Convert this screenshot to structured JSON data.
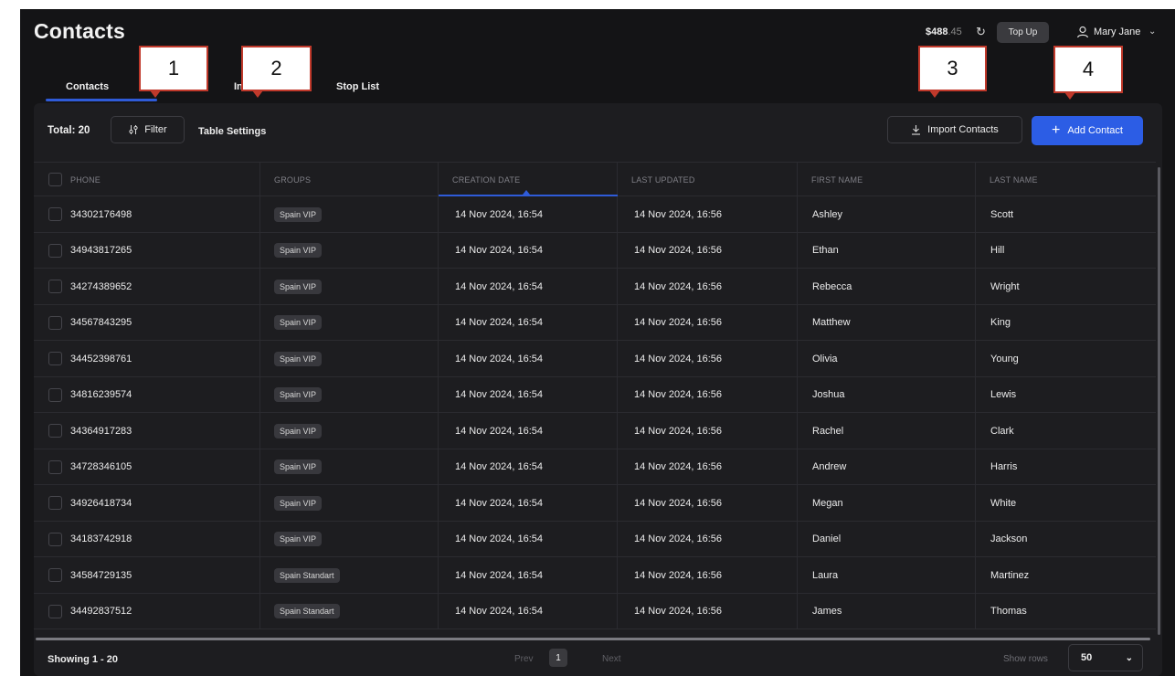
{
  "header": {
    "title": "Contacts",
    "balance_main": "$488",
    "balance_decimal": ".45",
    "topup_label": "Top Up",
    "user_name": "Mary Jane"
  },
  "tabs": [
    {
      "label": "Contacts",
      "active": true
    },
    {
      "label": "In"
    },
    {
      "label": "Stop List"
    }
  ],
  "toolbar": {
    "total_label": "Total: 20",
    "filter_label": "Filter",
    "table_settings_label": "Table Settings",
    "import_label": "Import Contacts",
    "add_label": "Add Contact"
  },
  "table": {
    "columns": [
      "PHONE",
      "GROUPS",
      "CREATION DATE",
      "LAST UPDATED",
      "FIRST NAME",
      "LAST NAME"
    ],
    "sorted_column": "CREATION DATE",
    "rows": [
      {
        "phone": "34302176498",
        "group": "Spain VIP",
        "created": "14 Nov 2024, 16:54",
        "updated": "14 Nov 2024, 16:56",
        "first": "Ashley",
        "last": "Scott"
      },
      {
        "phone": "34943817265",
        "group": "Spain VIP",
        "created": "14 Nov 2024, 16:54",
        "updated": "14 Nov 2024, 16:56",
        "first": "Ethan",
        "last": "Hill"
      },
      {
        "phone": "34274389652",
        "group": "Spain VIP",
        "created": "14 Nov 2024, 16:54",
        "updated": "14 Nov 2024, 16:56",
        "first": "Rebecca",
        "last": "Wright"
      },
      {
        "phone": "34567843295",
        "group": "Spain VIP",
        "created": "14 Nov 2024, 16:54",
        "updated": "14 Nov 2024, 16:56",
        "first": "Matthew",
        "last": "King"
      },
      {
        "phone": "34452398761",
        "group": "Spain VIP",
        "created": "14 Nov 2024, 16:54",
        "updated": "14 Nov 2024, 16:56",
        "first": "Olivia",
        "last": "Young"
      },
      {
        "phone": "34816239574",
        "group": "Spain VIP",
        "created": "14 Nov 2024, 16:54",
        "updated": "14 Nov 2024, 16:56",
        "first": "Joshua",
        "last": "Lewis"
      },
      {
        "phone": "34364917283",
        "group": "Spain VIP",
        "created": "14 Nov 2024, 16:54",
        "updated": "14 Nov 2024, 16:56",
        "first": "Rachel",
        "last": "Clark"
      },
      {
        "phone": "34728346105",
        "group": "Spain VIP",
        "created": "14 Nov 2024, 16:54",
        "updated": "14 Nov 2024, 16:56",
        "first": "Andrew",
        "last": "Harris"
      },
      {
        "phone": "34926418734",
        "group": "Spain VIP",
        "created": "14 Nov 2024, 16:54",
        "updated": "14 Nov 2024, 16:56",
        "first": "Megan",
        "last": "White"
      },
      {
        "phone": "34183742918",
        "group": "Spain VIP",
        "created": "14 Nov 2024, 16:54",
        "updated": "14 Nov 2024, 16:56",
        "first": "Daniel",
        "last": "Jackson"
      },
      {
        "phone": "34584729135",
        "group": "Spain Standart",
        "created": "14 Nov 2024, 16:54",
        "updated": "14 Nov 2024, 16:56",
        "first": "Laura",
        "last": "Martinez"
      },
      {
        "phone": "34492837512",
        "group": "Spain Standart",
        "created": "14 Nov 2024, 16:54",
        "updated": "14 Nov 2024, 16:56",
        "first": "James",
        "last": "Thomas"
      }
    ]
  },
  "footer": {
    "showing_label": "Showing 1 - 20",
    "prev_label": "Prev",
    "current_page": "1",
    "next_label": "Next",
    "show_rows_label": "Show rows",
    "rows_value": "50"
  },
  "callouts": [
    "1",
    "2",
    "3",
    "4"
  ],
  "colors": {
    "background": "#141416",
    "panel": "#1d1d20",
    "accent": "#2c5de5",
    "callout_border": "#c0392b"
  },
  "icons": {
    "filter": "sliders-icon",
    "refresh": "refresh-icon",
    "user": "user-icon",
    "import": "download-icon",
    "add": "plus-icon",
    "chevron": "chevron-down-icon"
  }
}
